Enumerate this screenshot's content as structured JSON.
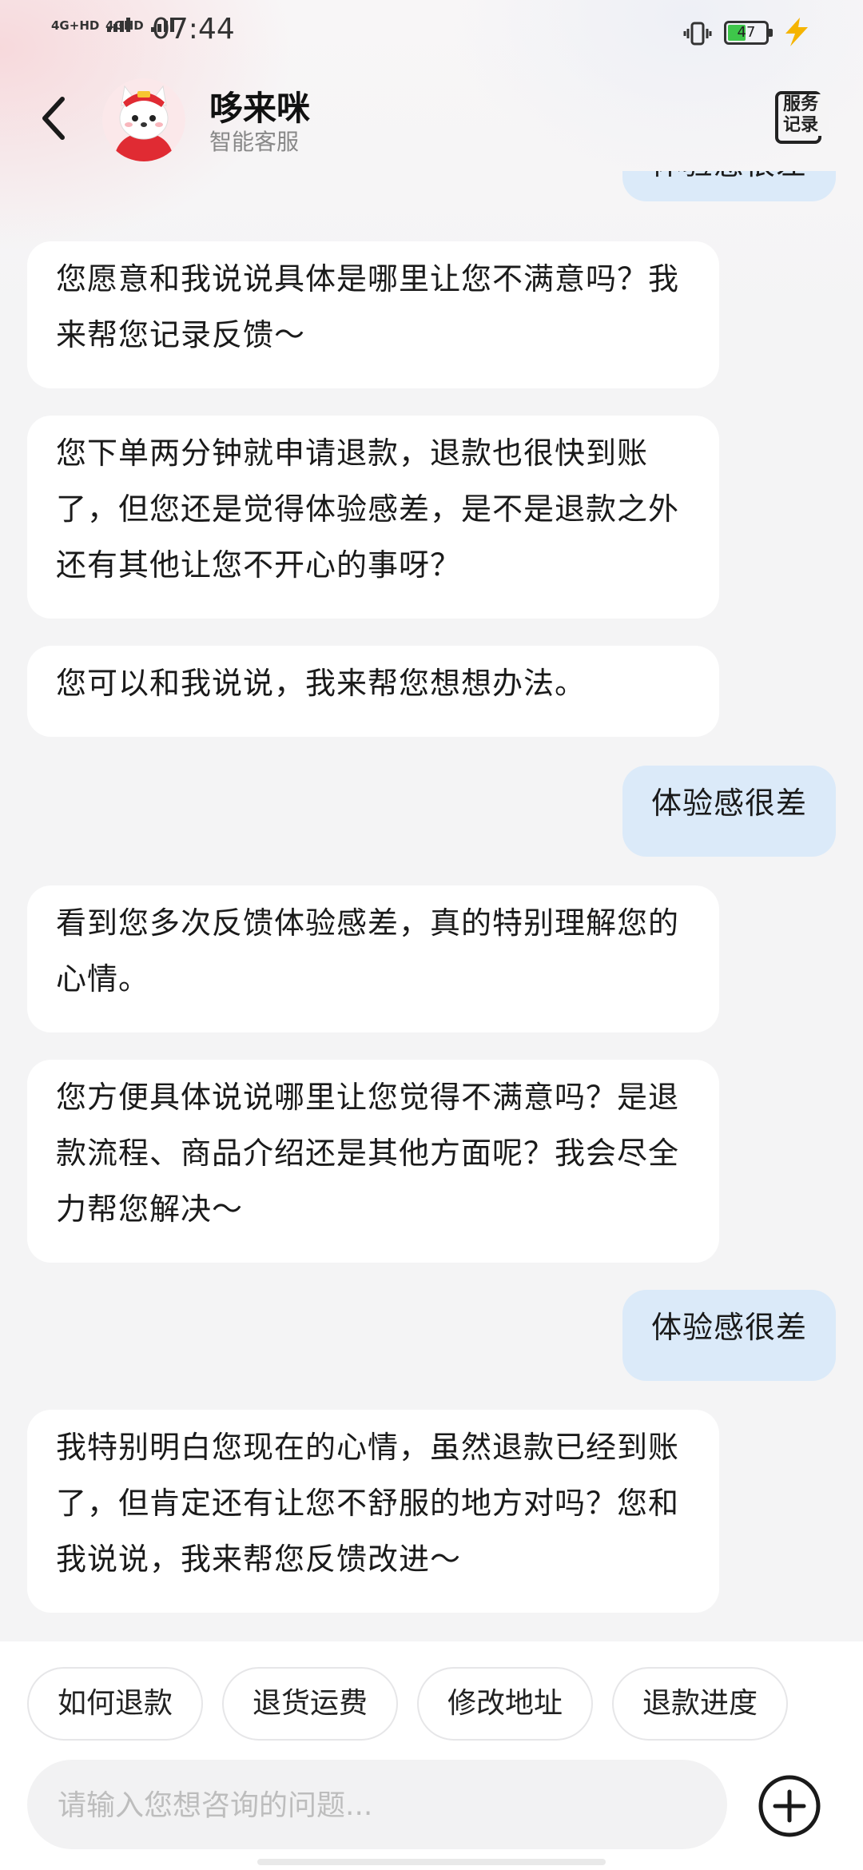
{
  "status": {
    "sig1": "4G+HD",
    "sig2": "4GHD",
    "time": "07:44",
    "battery": "47",
    "battery_level": 0.47
  },
  "header": {
    "name": "哆来咪",
    "subtitle": "智能客服",
    "service_record": "服务记录"
  },
  "messages": [
    {
      "role": "user",
      "text": "体验感很差"
    },
    {
      "role": "bot",
      "text": "您愿意和我说说具体是哪里让您不满意吗？我来帮您记录反馈～"
    },
    {
      "role": "bot",
      "text": "您下单两分钟就申请退款，退款也很快到账了，但您还是觉得体验感差，是不是退款之外还有其他让您不开心的事呀？"
    },
    {
      "role": "bot",
      "text": "您可以和我说说，我来帮您想想办法。"
    },
    {
      "role": "user",
      "text": "体验感很差"
    },
    {
      "role": "bot",
      "text": "看到您多次反馈体验感差，真的特别理解您的心情。"
    },
    {
      "role": "bot",
      "text": "您方便具体说说哪里让您觉得不满意吗？是退款流程、商品介绍还是其他方面呢？我会尽全力帮您解决～"
    },
    {
      "role": "user",
      "text": "体验感很差"
    },
    {
      "role": "bot",
      "text": "我特别明白您现在的心情，虽然退款已经到账了，但肯定还有让您不舒服的地方对吗？您和我说说，我来帮您反馈改进～"
    }
  ],
  "quick_replies": [
    "如何退款",
    "退货运费",
    "修改地址",
    "退款进度"
  ],
  "input": {
    "placeholder": "请输入您想咨询的问题...",
    "value": ""
  },
  "icons": {
    "back": "chevron-left-icon",
    "plus": "plus-circle-icon",
    "service": "service-record-icon"
  }
}
